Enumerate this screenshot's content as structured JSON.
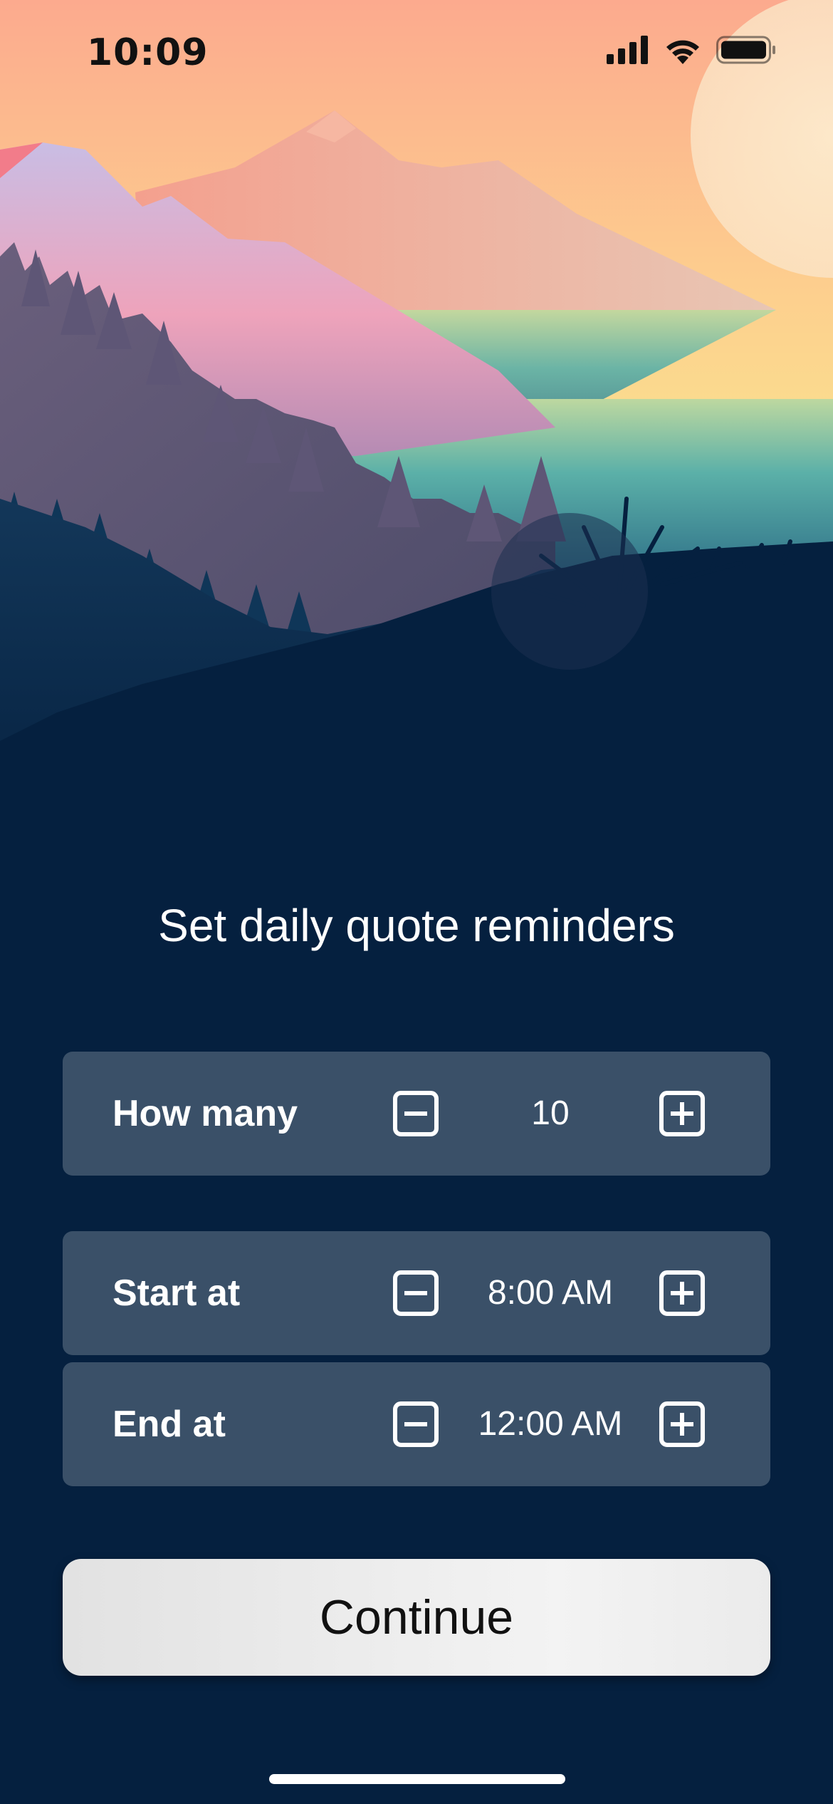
{
  "status_bar": {
    "time": "10:09"
  },
  "screen": {
    "title": "Set daily quote reminders"
  },
  "rows": [
    {
      "label": "How many",
      "value": "10"
    },
    {
      "label": "Start at",
      "value": "8:00 AM"
    },
    {
      "label": "End at",
      "value": "12:00 AM"
    }
  ],
  "continue_label": "Continue",
  "icons": [
    "cellular-signal-icon",
    "wifi-icon",
    "battery-icon",
    "minus-square-icon",
    "plus-square-icon"
  ],
  "colors": {
    "background": "#05203f",
    "row_background": "#3a5068",
    "button_background": "#ececec"
  }
}
